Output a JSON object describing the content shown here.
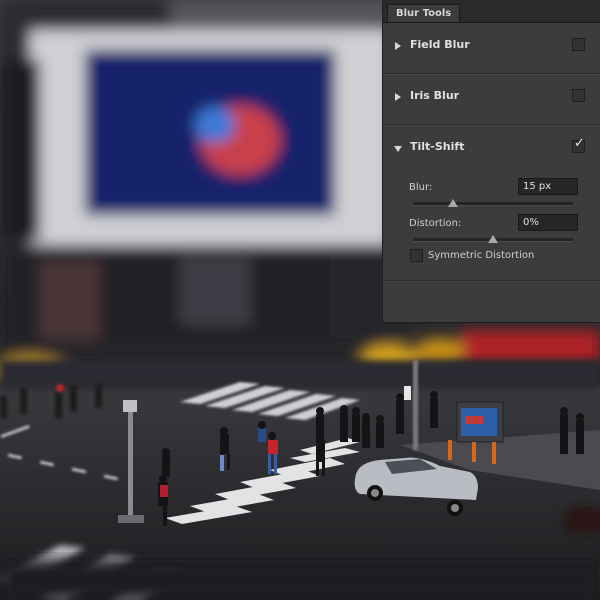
{
  "panel": {
    "tab_label": "Blur Tools",
    "sections": [
      {
        "label": "Field Blur",
        "expanded": false,
        "checked": false
      },
      {
        "label": "Iris Blur",
        "expanded": false,
        "checked": false
      },
      {
        "label": "Tilt-Shift",
        "expanded": true,
        "checked": true,
        "check_glyph": "✓"
      }
    ],
    "tilt_shift": {
      "blur_label": "Blur:",
      "blur_value": "15 px",
      "blur_slider_fraction": 0.25,
      "distortion_label": "Distortion:",
      "distortion_value": "0%",
      "distortion_slider_fraction": 0.5,
      "symmetric_label": "Symmetric Distortion",
      "symmetric_checked": false
    }
  },
  "icons": {
    "collapsed_arrow": "triangle-right-icon",
    "expanded_arrow": "triangle-down-icon",
    "checkmark": "checkmark-icon"
  },
  "colors": {
    "panel_bg": "#3c3c3c",
    "tabbar_bg": "#2a2a2a",
    "field_bg": "#262626",
    "text": "#e0e0e0"
  }
}
